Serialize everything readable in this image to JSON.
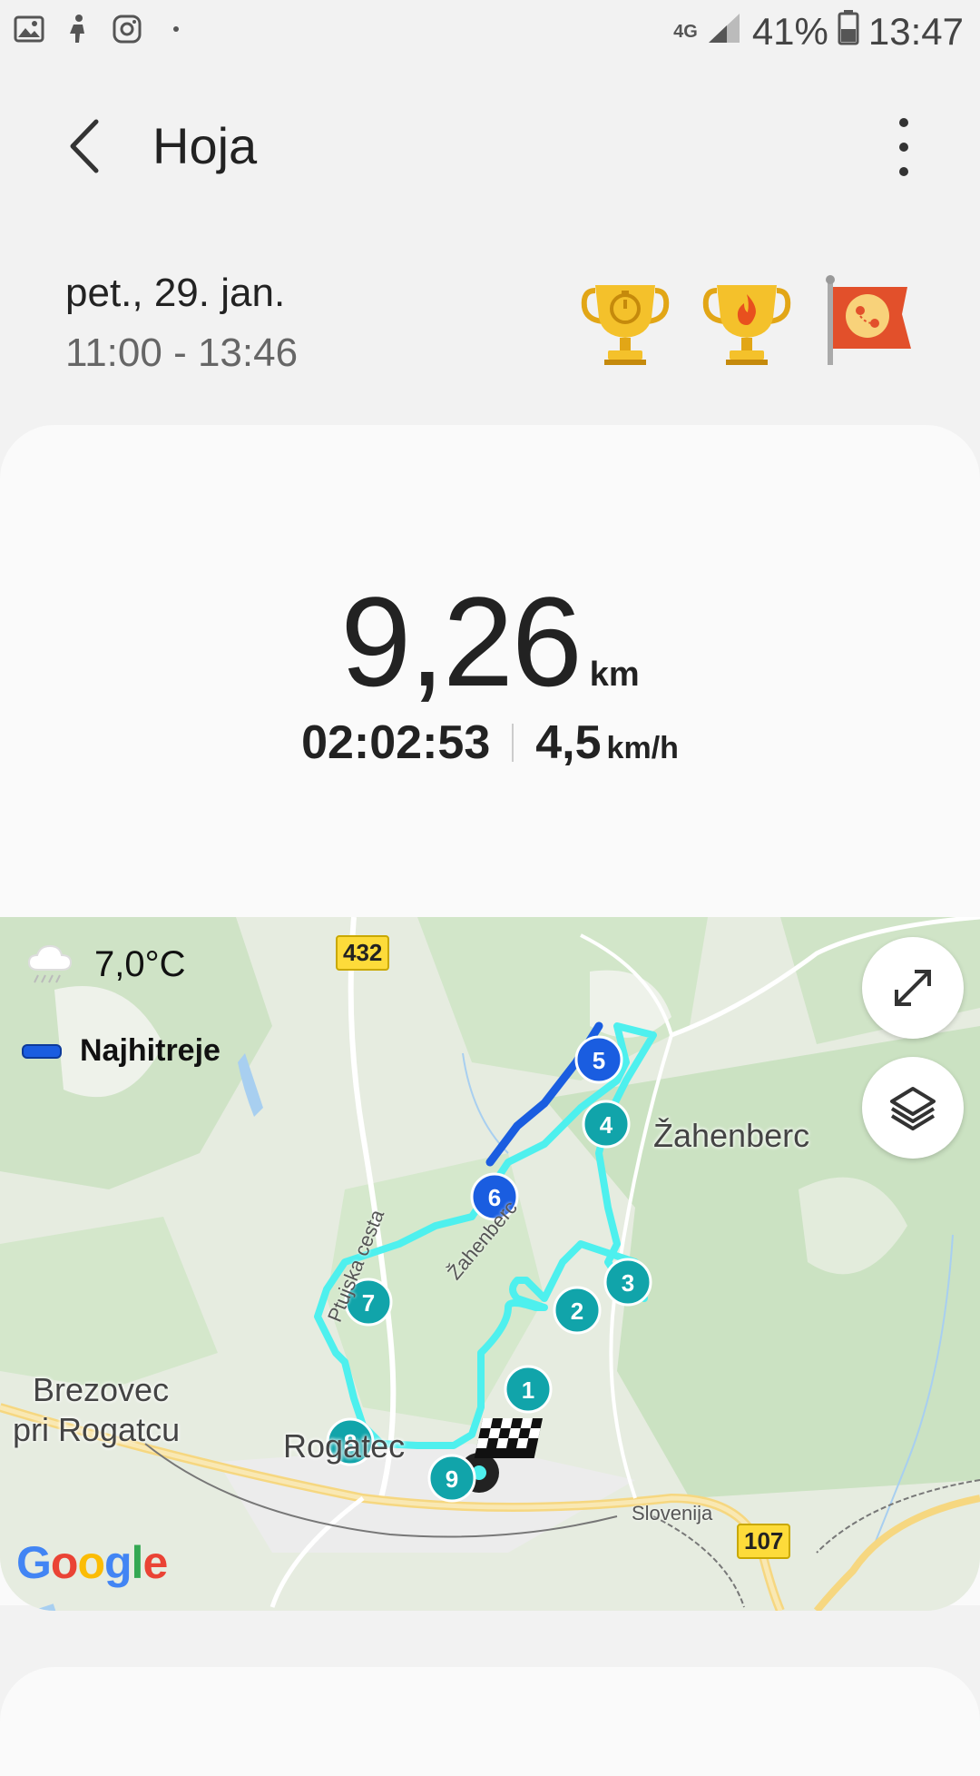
{
  "status_bar": {
    "network": "4G",
    "battery": "41%",
    "time": "13:47"
  },
  "header": {
    "title": "Hoja"
  },
  "session": {
    "date": "pet., 29. jan.",
    "time_range": "11:00 - 13:46"
  },
  "stats": {
    "distance": "9,26",
    "distance_unit": "km",
    "duration": "02:02:53",
    "speed": "4,5",
    "speed_unit": "km/h"
  },
  "map": {
    "temperature": "7,0°C",
    "legend_label": "Najhitreje",
    "legend_color": "#1a5de0",
    "route_color": "#4ef0ee",
    "markers": [
      "1",
      "2",
      "3",
      "4",
      "5",
      "6",
      "7",
      "8",
      "9"
    ],
    "places": {
      "town1": "Žahenberc",
      "town2_line1": "Brezovec",
      "town2_line2": "pri Rogatcu",
      "town3": "Rogatec",
      "country": "Slovenija",
      "street1": "Ptujska cesta",
      "street2": "Žahenberc"
    },
    "road_signs": [
      "432",
      "107"
    ],
    "attribution": "Google"
  }
}
